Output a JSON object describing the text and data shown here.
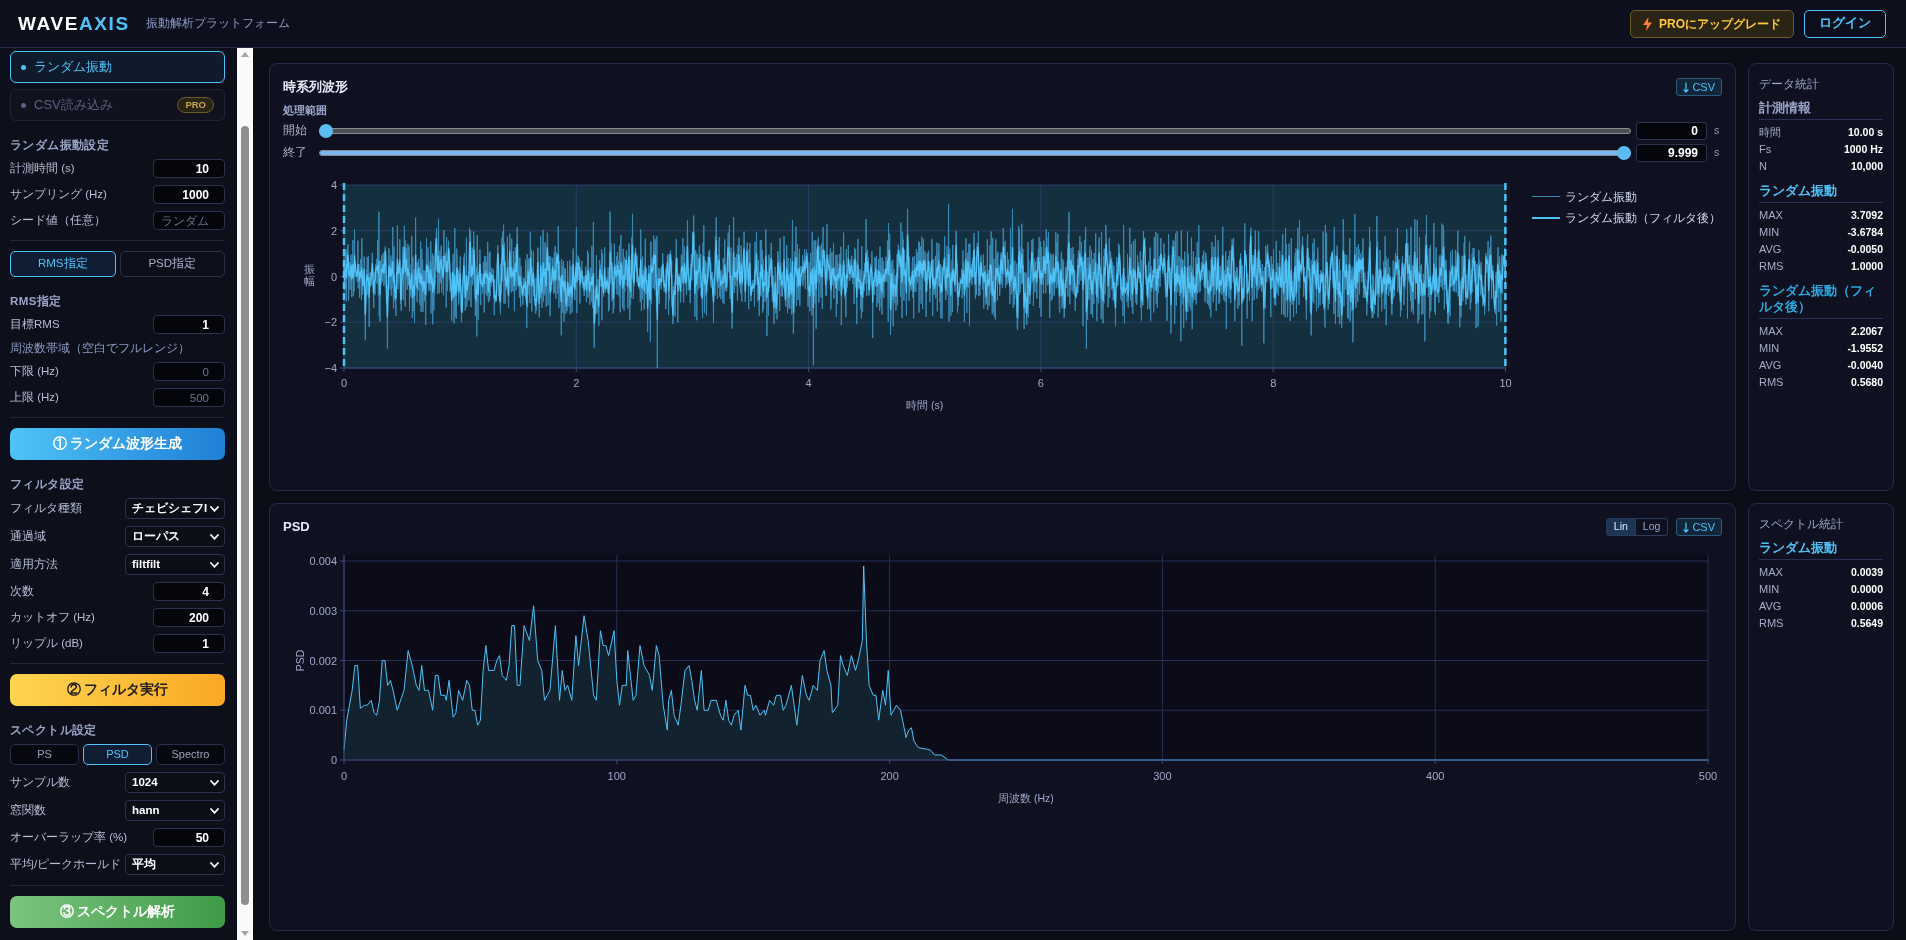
{
  "header": {
    "logo": {
      "text": "WAVE",
      "accent": "AXIS"
    },
    "subtitle": "振動解析プラットフォーム",
    "upgrade_button": "PROにアップグレード",
    "login_button": "ログイン"
  },
  "sidebar": {
    "mode_tabs": [
      {
        "label": "ランダム振動",
        "selected": true,
        "disabled": false
      },
      {
        "label": "CSV読み込み",
        "selected": false,
        "disabled": true,
        "badge": "PRO"
      }
    ],
    "random_settings": {
      "title": "ランダム振動設定",
      "fields": [
        {
          "kind": "input",
          "label": "計測時間 (s)",
          "value": "10"
        },
        {
          "kind": "input",
          "label": "サンプリング (Hz)",
          "value": "1000"
        },
        {
          "kind": "input",
          "label": "シード値（任意）",
          "placeholder": "ランダム"
        }
      ]
    },
    "level_mode": [
      {
        "label": "RMS指定",
        "selected": true
      },
      {
        "label": "PSD指定",
        "selected": false
      }
    ],
    "rms_settings": {
      "title": "RMS指定",
      "fields": [
        {
          "kind": "input",
          "label": "目標RMS",
          "value": "1"
        },
        {
          "kind": "note",
          "label": "周波数帯域（空白でフルレンジ）"
        },
        {
          "kind": "input",
          "label": "下限 (Hz)",
          "placeholder": "0"
        },
        {
          "kind": "input",
          "label": "上限 (Hz)",
          "placeholder": "500"
        }
      ]
    },
    "generate_button": "① ランダム波形生成",
    "filter_settings": {
      "title": "フィルタ設定",
      "fields": [
        {
          "kind": "select",
          "label": "フィルタ種類",
          "value": "チェビシェフI"
        },
        {
          "kind": "select",
          "label": "通過域",
          "value": "ローパス"
        },
        {
          "kind": "select",
          "label": "適用方法",
          "value": "filtfilt"
        },
        {
          "kind": "input",
          "label": "次数",
          "value": "4"
        },
        {
          "kind": "input",
          "label": "カットオフ (Hz)",
          "value": "200"
        },
        {
          "kind": "input",
          "label": "リップル (dB)",
          "value": "1"
        }
      ]
    },
    "filter_button": "② フィルタ実行",
    "spectrum_settings": {
      "title": "スペクトル設定",
      "types": [
        {
          "label": "PS",
          "selected": false
        },
        {
          "label": "PSD",
          "selected": true
        },
        {
          "label": "Spectro",
          "selected": false
        }
      ],
      "fields": [
        {
          "kind": "select",
          "label": "サンプル数",
          "value": "1024"
        },
        {
          "kind": "select",
          "label": "窓関数",
          "value": "hann"
        },
        {
          "kind": "input",
          "label": "オーバーラップ率 (%)",
          "value": "50"
        },
        {
          "kind": "select",
          "label": "平均/ピークホールド",
          "value": "平均"
        }
      ]
    },
    "analyze_button": "③ スペクトル解析"
  },
  "waveform_panel": {
    "title": "時系列波形",
    "csv_button": "CSV",
    "range": {
      "label": "処理範囲",
      "sliders": [
        {
          "label": "開始",
          "level": 0,
          "value": "0",
          "unit": "s"
        },
        {
          "label": "終了",
          "level": 0.9999,
          "value": "9.999",
          "unit": "s"
        }
      ]
    },
    "chart": {
      "y_label": "振幅",
      "x_label": "時間 (s)",
      "y_ticks": [
        "4",
        "2",
        "0",
        "−2",
        "−4"
      ],
      "x_ticks": [
        "0",
        "2",
        "4",
        "6",
        "8",
        "10"
      ],
      "legend": [
        {
          "kind": "raw",
          "label": "ランダム振動",
          "color": "#3a8ab5"
        },
        {
          "kind": "filtered",
          "label": "ランダム振動（フィルタ後）",
          "color": "#4fc3f7"
        }
      ]
    }
  },
  "psd_panel": {
    "title": "PSD",
    "scales": [
      {
        "label": "Lin",
        "selected": true
      },
      {
        "label": "Log",
        "selected": false
      }
    ],
    "csv_button": "CSV",
    "chart_data": {
      "type": "area",
      "xlabel": "周波数 (Hz)",
      "ylabel": "PSD",
      "xlim": [
        0,
        500
      ],
      "ylim": [
        0,
        0.004
      ],
      "xticks": [
        0,
        100,
        200,
        300,
        400,
        500
      ],
      "yticks": [
        0,
        0.001,
        0.002,
        0.003,
        0.004
      ],
      "grid": true,
      "x": [
        0,
        1,
        3,
        4,
        5,
        6,
        7.5,
        8.5,
        10,
        11,
        12,
        13,
        14,
        15,
        16,
        17,
        18,
        19.5,
        22,
        23.5,
        25,
        26.5,
        27.5,
        28.5,
        29.5,
        31,
        32.5,
        33.5,
        34.5,
        35.5,
        37,
        37.5,
        38.5,
        40,
        41,
        42,
        43.5,
        45,
        46,
        47,
        48,
        49,
        50,
        51,
        52,
        53,
        55,
        56,
        57,
        58,
        59.5,
        60.5,
        61.5,
        62.5,
        63.5,
        64.5,
        66,
        68,
        69.5,
        71,
        72.5,
        73.5,
        74.5,
        75.5,
        77.5,
        79,
        80,
        81,
        82,
        83.5,
        85,
        86,
        88,
        89.5,
        91.5,
        92.5,
        94,
        95,
        96,
        97,
        99,
        100,
        101,
        102,
        103.5,
        104,
        105,
        106,
        107,
        108.5,
        110,
        111,
        112,
        113,
        114.5,
        115.5,
        117,
        118.5,
        119,
        120,
        121,
        122.5,
        123.5,
        125,
        126.5,
        127.5,
        128.5,
        129.5,
        131,
        132,
        133.5,
        134.5,
        136.5,
        138,
        139,
        140,
        141,
        142,
        143,
        144.5,
        145.5,
        147,
        148,
        149,
        150,
        151,
        152.5,
        154,
        154.5,
        156,
        157.5,
        158.5,
        160,
        161,
        162,
        164,
        166,
        168,
        169.5,
        170.5,
        172,
        173.5,
        174.5,
        176,
        177,
        178.5,
        179,
        181,
        182,
        183,
        184.5,
        186,
        187.5,
        188.5,
        190,
        190.5,
        191.5,
        192.5,
        194,
        195,
        196,
        197,
        197.5,
        198.5,
        199.5,
        200.5,
        201.5,
        202.5,
        204,
        205.5,
        206,
        207,
        208,
        209,
        210.5,
        212,
        213.5,
        215,
        216.5,
        219,
        221.5,
        225,
        240,
        300,
        400,
        500
      ],
      "values": [
        0.0002,
        0.0008,
        0.0014,
        0.0019,
        0.0019,
        0.00104,
        0.0011,
        0.0011,
        0.0012,
        0.00095,
        0.0009,
        0.0012,
        0.002,
        0.002,
        0.0015,
        0.0016,
        0.0014,
        0.001,
        0.0014,
        0.0022,
        0.0019,
        0.0015,
        0.0014,
        0.0019,
        0.0014,
        0.0014,
        0.001,
        0.0017,
        0.0017,
        0.0013,
        0.0013,
        0.0012,
        0.0016,
        0.00086,
        0.00095,
        0.0014,
        0.0012,
        0.0016,
        0.0015,
        0.001,
        0.001,
        0.0007,
        0.0008,
        0.0018,
        0.0023,
        0.0018,
        0.0018,
        0.002,
        0.0021,
        0.0017,
        0.0016,
        0.0019,
        0.0027,
        0.0027,
        0.0015,
        0.0015,
        0.0027,
        0.0024,
        0.0031,
        0.002,
        0.0018,
        0.0012,
        0.0013,
        0.0014,
        0.0027,
        0.0012,
        0.0018,
        0.0014,
        0.0015,
        0.0012,
        0.0025,
        0.0019,
        0.0029,
        0.0024,
        0.0013,
        0.0012,
        0.0026,
        0.0023,
        0.0023,
        0.0021,
        0.0026,
        0.0016,
        0.0011,
        0.0015,
        0.0015,
        0.0022,
        0.0017,
        0.0012,
        0.0013,
        0.0023,
        0.0019,
        0.0018,
        0.0017,
        0.0014,
        0.0023,
        0.0021,
        0.0011,
        0.0006,
        0.0012,
        0.0014,
        0.0009,
        0.0007,
        0.0011,
        0.0018,
        0.0019,
        0.0016,
        0.0012,
        0.001,
        0.0018,
        0.001,
        0.001,
        0.0012,
        0.0012,
        0.0009,
        0.0008,
        0.0012,
        0.0008,
        0.0007,
        0.0009,
        0.001,
        0.0006,
        0.0015,
        0.0013,
        0.0013,
        0.001,
        0.0011,
        0.0009,
        0.001,
        0.0009,
        0.0012,
        0.0011,
        0.0013,
        0.0013,
        0.001,
        0.0011,
        0.0015,
        0.0007,
        0.0017,
        0.0013,
        0.0012,
        0.0015,
        0.0014,
        0.002,
        0.0022,
        0.0018,
        0.0015,
        0.00095,
        0.0011,
        0.0021,
        0.0019,
        0.0017,
        0.0021,
        0.0018,
        0.002,
        0.0024,
        0.0039,
        0.0024,
        0.0015,
        0.0013,
        0.0013,
        0.0008,
        0.0012,
        0.0014,
        0.0011,
        0.0018,
        0.0009,
        0.001,
        0.0011,
        0.001,
        0.0006,
        0.00045,
        0.0006,
        0.00065,
        0.00037,
        0.00025,
        0.00023,
        0.00022,
        0.0002,
        0.0001,
        0.0001,
        0,
        0,
        0,
        0,
        0,
        0
      ]
    }
  },
  "data_stats": {
    "title": "データ統計",
    "sections": [
      {
        "heading": "計測情報",
        "color": "#9aa5c8",
        "rows": [
          {
            "label": "時間",
            "value": "10.00 s"
          },
          {
            "label": "Fs",
            "value": "1000 Hz"
          },
          {
            "label": "N",
            "value": "10,000"
          }
        ]
      },
      {
        "heading": "ランダム振動",
        "color": "#4fc3f7",
        "rows": [
          {
            "label": "MAX",
            "value": "3.7092"
          },
          {
            "label": "MIN",
            "value": "-3.6784"
          },
          {
            "label": "AVG",
            "value": "-0.0050"
          },
          {
            "label": "RMS",
            "value": "1.0000"
          }
        ]
      },
      {
        "heading": "ランダム振動（フィルタ後）",
        "color": "#2aa7dc",
        "rows": [
          {
            "label": "MAX",
            "value": "2.2067"
          },
          {
            "label": "MIN",
            "value": "-1.9552"
          },
          {
            "label": "AVG",
            "value": "-0.0040"
          },
          {
            "label": "RMS",
            "value": "0.5680"
          }
        ]
      }
    ]
  },
  "spectrum_stats": {
    "title": "スペクトル統計",
    "sections": [
      {
        "heading": "ランダム振動",
        "color": "#4fc3f7",
        "rows": [
          {
            "label": "MAX",
            "value": "0.0039"
          },
          {
            "label": "MIN",
            "value": "0.0000"
          },
          {
            "label": "AVG",
            "value": "0.0006"
          },
          {
            "label": "RMS",
            "value": "0.5649"
          }
        ]
      }
    ]
  }
}
